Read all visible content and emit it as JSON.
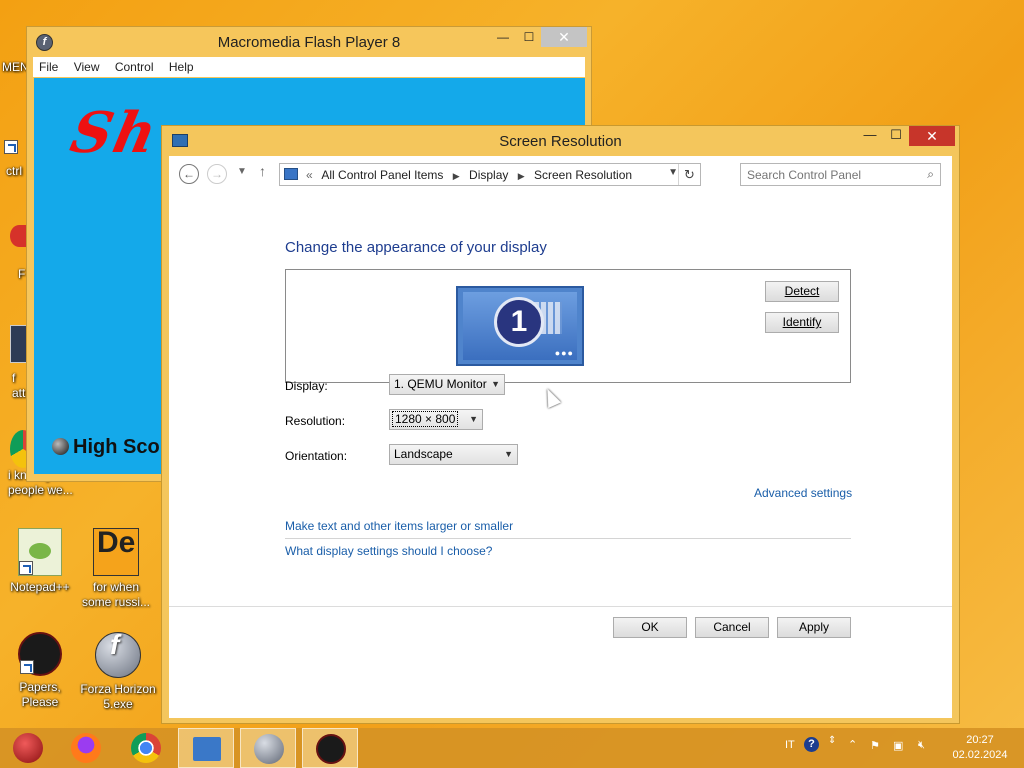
{
  "desktop": {
    "icons": [
      {
        "label": "MEN"
      },
      {
        "label": "ctrl"
      },
      {
        "label": "F"
      },
      {
        "label": "f\natt"
      },
      {
        "label": "i know you\npeople we..."
      },
      {
        "label": "Notepad++"
      },
      {
        "label": "for when\nsome russi..."
      },
      {
        "label": "Papers, Please"
      },
      {
        "label": "Forza Horizon\n5.exe"
      }
    ]
  },
  "flash_window": {
    "title": "Macromedia Flash Player 8",
    "menu": [
      "File",
      "View",
      "Control",
      "Help"
    ],
    "game_title": "Sh",
    "high_score": "High Sco"
  },
  "screen_resolution": {
    "title": "Screen Resolution",
    "breadcrumb": [
      "All Control Panel Items",
      "Display",
      "Screen Resolution"
    ],
    "breadcrumb_prefix": "«",
    "search_placeholder": "Search Control Panel",
    "heading": "Change the appearance of your display",
    "monitor_number": "1",
    "detect_label": "Detect",
    "identify_label": "Identify",
    "display_label": "Display:",
    "display_value": "1. QEMU Monitor",
    "resolution_label": "Resolution:",
    "resolution_value": "1280 × 800",
    "orientation_label": "Orientation:",
    "orientation_value": "Landscape",
    "advanced_link": "Advanced settings",
    "text_size_link": "Make text and other items larger or smaller",
    "help_link": "What display settings should I choose?",
    "ok_label": "OK",
    "cancel_label": "Cancel",
    "apply_label": "Apply"
  },
  "taskbar": {
    "language": "IT",
    "time": "20:27",
    "date": "02.02.2024"
  }
}
